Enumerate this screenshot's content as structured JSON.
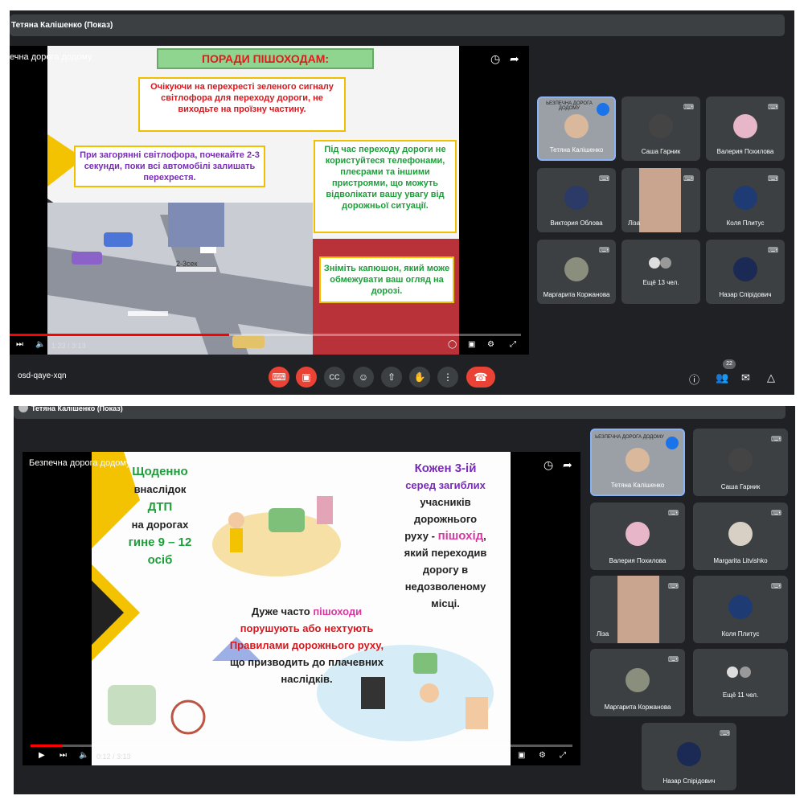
{
  "shot1": {
    "presenter_label": "Тетяна Калішенко (Показ)",
    "video_title": "ечна дорога додому",
    "slide": {
      "heading": "ПОРАДИ ПІШОХОДАМ:",
      "box1": "Очікуючи на перехресті зеленого сигналу світлофора для переходу дороги, не виходьте на проїзну частину.",
      "box2": "При загорянні світлофора, почекайте 2-3 секунди, поки всі автомобілі залишать перехрестя.",
      "box3": "Під час переходу дороги не користуйтеся телефонами, плеєрами та іншими пристроями, що можуть відволікати вашу увагу від дорожньої ситуації.",
      "box4": "Зніміть капюшон, який може обмежувати ваш огляд на дорозі.",
      "scene_label": "2-3сек"
    },
    "time": "1:23 / 3:13",
    "progress": 0.43,
    "meeting_code": "osd-qaye-xqn",
    "people_count": "22",
    "participants": [
      {
        "name": "Тетяна Калішенко",
        "overlay": "ЬЕЗПЕЧНА ДОРОГА ДОДОМУ"
      },
      {
        "name": "Саша Гарник"
      },
      {
        "name": "Валерия Похилова"
      },
      {
        "name": "Виктория Облова"
      },
      {
        "name": "Ліза"
      },
      {
        "name": "Коля Плитус"
      },
      {
        "name": "Маргарита Коржанова"
      },
      {
        "name": "Ещё 13 чел."
      },
      {
        "name": "Назар Спірідович"
      }
    ]
  },
  "shot2": {
    "presenter_label": "Тетяна Калішенко (Показ)",
    "video_title": "Безпечна дорога додому",
    "slide": {
      "left_line1": "Щоденно",
      "left_line2": "внаслідок",
      "left_line3": "ДТП",
      "left_line4": "на дорогах",
      "left_line5": "гине 9 – 12",
      "left_line6": "осіб",
      "right_line1": "Кожен 3-ій",
      "right_line2": "серед загиблих",
      "right_line3": "учасників",
      "right_line4": "дорожнього",
      "right_line5a": "руху  -",
      "right_line5b": "пішохід",
      "right_line5c": ",",
      "right_line6": "який переходив",
      "right_line7": "дорогу в",
      "right_line8": "недозволеному",
      "right_line9": "місці.",
      "mid_line1": "Дуже часто",
      "mid_line1b": "пішоходи",
      "mid_line2": "порушують або нехтують",
      "mid_line3": "Правилами дорожнього руху,",
      "mid_line4": "що призводить до плачевних",
      "mid_line5": "наслідків."
    },
    "time": "0:12 / 3:13",
    "progress": 0.06,
    "participants": [
      {
        "name": "Тетяна Калішенко",
        "overlay": "ЬЕЗПЕЧНА ДОРОГА ДОДОМУ"
      },
      {
        "name": "Саша Гарник"
      },
      {
        "name": "Валерия Похилова"
      },
      {
        "name": "Margarita Litvishko"
      },
      {
        "name": "Ліза"
      },
      {
        "name": "Коля Плитус"
      },
      {
        "name": "Маргарита Коржанова"
      },
      {
        "name": "Ещё 11 чел."
      },
      {
        "name": "Назар Спірідович"
      }
    ]
  },
  "colors": {
    "dark_bg": "#202124",
    "tile_bg": "#3c4043",
    "danger": "#ea4335",
    "active_blue": "#8ab4f8",
    "accent_yellow": "#f3c200",
    "text_green": "#1e9e3a",
    "text_purple": "#7a2bb8",
    "text_red": "#d6191e",
    "text_pink": "#d63aa0"
  }
}
